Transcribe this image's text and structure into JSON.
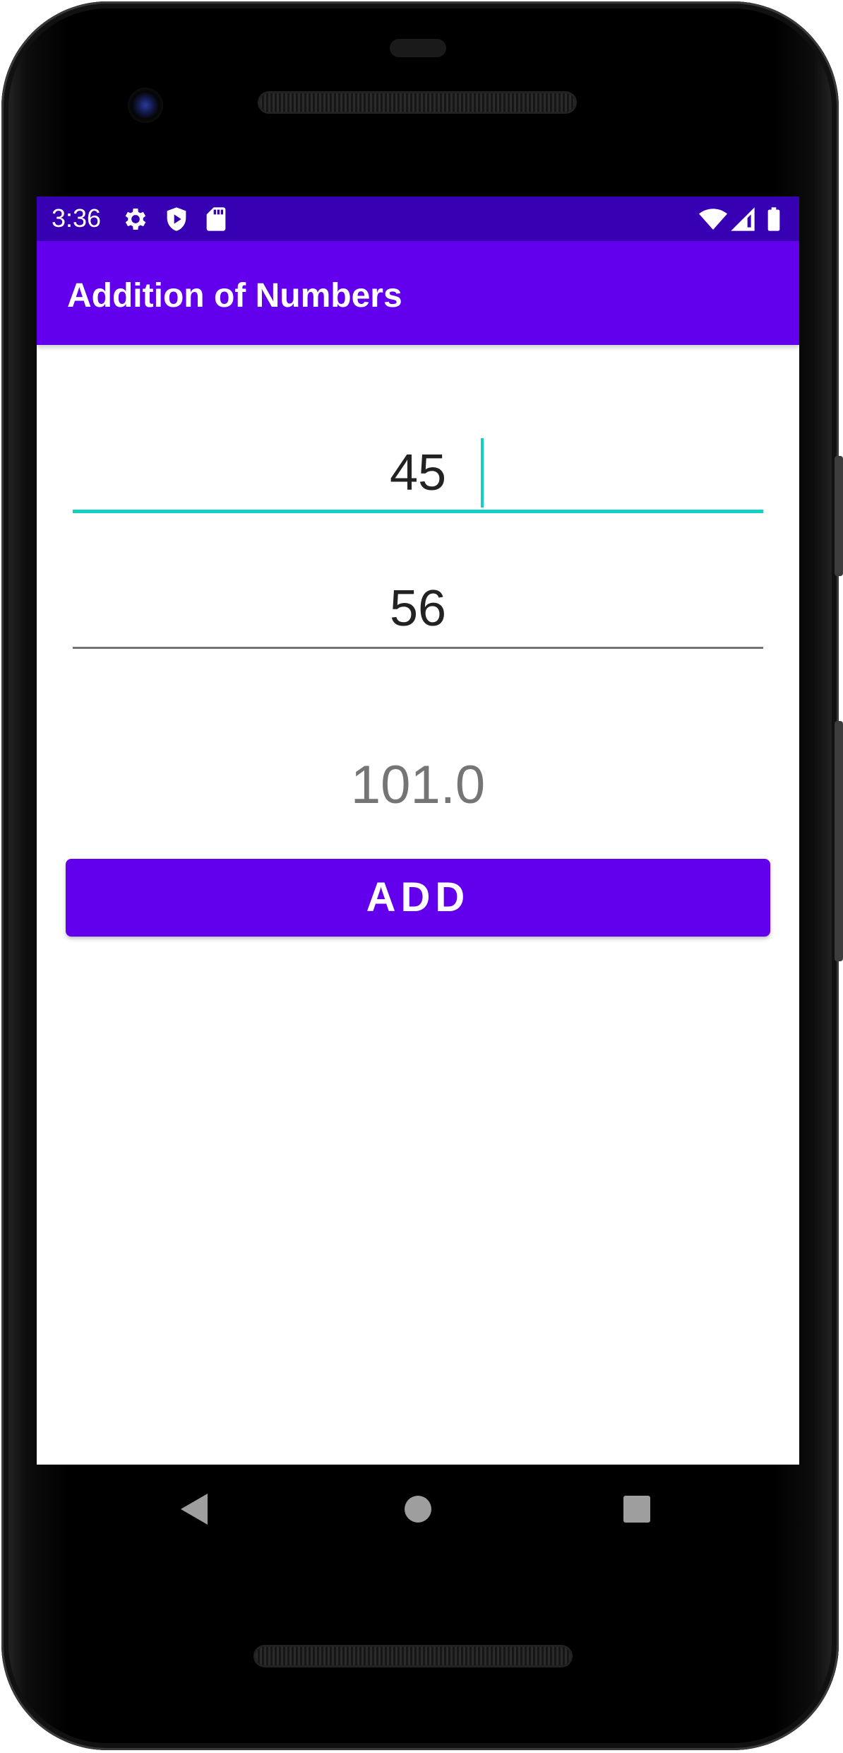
{
  "status_bar": {
    "time": "3:36",
    "icons": [
      "gear-icon",
      "shield-icon",
      "sd-card-icon",
      "wifi-icon",
      "signal-icon",
      "battery-icon"
    ],
    "color": "#3700b3"
  },
  "app_bar": {
    "title": "Addition of Numbers",
    "color": "#6200ee"
  },
  "form": {
    "first_number": "45",
    "second_number": "56",
    "result": "101.0",
    "add_label": "ADD",
    "accent_color": "#13d0c4"
  },
  "nav_bar": {
    "icons": [
      "back-icon",
      "home-icon",
      "recents-icon"
    ]
  }
}
